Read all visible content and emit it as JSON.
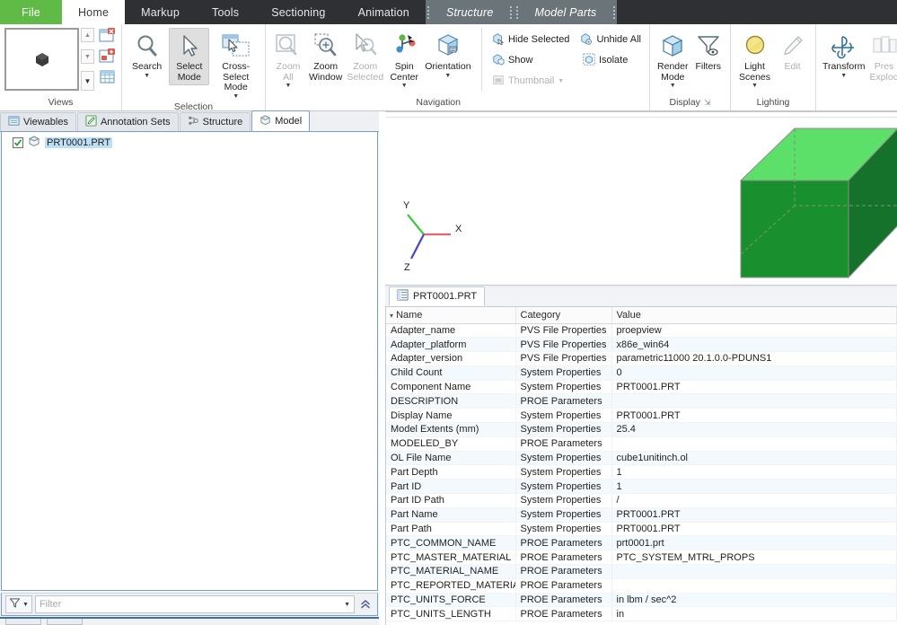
{
  "ribbon_tabs": [
    {
      "label": "File",
      "kind": "file",
      "active": false
    },
    {
      "label": "Home",
      "kind": "normal",
      "active": true
    },
    {
      "label": "Markup",
      "kind": "normal",
      "active": false
    },
    {
      "label": "Tools",
      "kind": "normal",
      "active": false
    },
    {
      "label": "Sectioning",
      "kind": "normal",
      "active": false
    },
    {
      "label": "Animation",
      "kind": "normal",
      "active": false
    }
  ],
  "contextual_tabs": [
    {
      "label": "Structure"
    },
    {
      "label": "Model Parts"
    }
  ],
  "ribbon_groups": {
    "views": {
      "label": "Views",
      "thumbnail_icon": "model-thumbnail-icon",
      "scroll_up": "scroll-up-icon",
      "scroll_down": "scroll-down-icon",
      "more": "more-views-icon",
      "side_buttons": [
        {
          "name": "delete-view-icon"
        },
        {
          "name": "new-view-icon"
        },
        {
          "name": "view-grid-icon"
        }
      ]
    },
    "selection": {
      "label": "Selection",
      "buttons": [
        {
          "label": "Search",
          "icon": "search-icon",
          "dropdown": true,
          "selected": false,
          "disabled": false
        },
        {
          "label": "Select\nMode",
          "icon": "select-mode-icon",
          "dropdown": true,
          "selected": true,
          "disabled": false
        },
        {
          "label": "Cross-Select\nMode",
          "icon": "cross-select-mode-icon",
          "dropdown": true,
          "selected": false,
          "disabled": false
        }
      ]
    },
    "navigation": {
      "label": "Navigation",
      "buttons": [
        {
          "label": "Zoom\nAll",
          "icon": "zoom-all-icon",
          "dropdown": true,
          "disabled": true
        },
        {
          "label": "Zoom\nWindow",
          "icon": "zoom-window-icon",
          "dropdown": false,
          "disabled": false
        },
        {
          "label": "Zoom\nSelected",
          "icon": "zoom-selected-icon",
          "dropdown": false,
          "disabled": true
        },
        {
          "label": "Spin\nCenter",
          "icon": "spin-center-icon",
          "dropdown": true,
          "disabled": false
        },
        {
          "label": "Orientation",
          "icon": "orientation-icon",
          "dropdown": true,
          "disabled": false
        }
      ],
      "small_buttons": [
        {
          "label": "Hide Selected",
          "icon": "hide-selected-icon",
          "disabled": false,
          "dropdown": false
        },
        {
          "label": "Unhide All",
          "icon": "unhide-all-icon",
          "disabled": false,
          "dropdown": false
        },
        {
          "label": "Show",
          "icon": "show-icon",
          "disabled": false,
          "dropdown": false
        },
        {
          "label": "Isolate",
          "icon": "isolate-icon",
          "disabled": false,
          "dropdown": false
        },
        {
          "label": "Thumbnail",
          "icon": "thumbnail-icon",
          "disabled": true,
          "dropdown": true
        }
      ]
    },
    "display": {
      "label": "Display",
      "dialog_launcher": "dialog-launcher-icon",
      "buttons": [
        {
          "label": "Render\nMode",
          "icon": "render-mode-icon",
          "dropdown": true,
          "disabled": false
        },
        {
          "label": "Filters",
          "icon": "filters-icon",
          "dropdown": false,
          "disabled": false
        }
      ]
    },
    "lighting": {
      "label": "Lighting",
      "buttons": [
        {
          "label": "Light\nScenes",
          "icon": "light-scenes-icon",
          "dropdown": true,
          "disabled": false
        },
        {
          "label": "Edit",
          "icon": "edit-pencil-icon",
          "dropdown": false,
          "disabled": true
        }
      ]
    },
    "transform_group": {
      "label": "",
      "buttons": [
        {
          "label": "Transform",
          "icon": "transform-icon",
          "dropdown": true,
          "disabled": false
        },
        {
          "label": "Pres\nExplod",
          "icon": "presentation-explode-icon",
          "dropdown": false,
          "disabled": true
        }
      ]
    }
  },
  "left_panel": {
    "tabs": [
      {
        "label": "Viewables",
        "icon": "viewables-icon",
        "active": false
      },
      {
        "label": "Annotation Sets",
        "icon": "annotation-sets-icon",
        "active": false
      },
      {
        "label": "Structure",
        "icon": "structure-icon",
        "active": false
      },
      {
        "label": "Model",
        "icon": "model-icon",
        "active": true
      }
    ],
    "tree": [
      {
        "label": "PRT0001.PRT",
        "checked": true,
        "selected": true,
        "icon": "part-cube-icon"
      }
    ],
    "filter": {
      "icon": "filter-funnel-icon",
      "placeholder": "Filter",
      "value": "",
      "dropdown_icon": "chevron-down-icon",
      "collapse_icon": "chevron-double-up-icon"
    }
  },
  "viewport": {
    "axes": {
      "x_label": "X",
      "y_label": "Y",
      "z_label": "Z",
      "x_color": "#e8646c",
      "y_color": "#3cc83c",
      "z_color": "#4444cc"
    },
    "model": {
      "name": "cube",
      "top_face_color": "#5ce06a",
      "front_face_color": "#1a8f2e",
      "right_face_color": "#14722a",
      "edge_color": "#7d7d7d"
    }
  },
  "properties": {
    "tab": {
      "label": "PRT0001.PRT",
      "icon": "properties-table-icon"
    },
    "sort_indicator": "sort-descending-icon",
    "columns": [
      "Name",
      "Category",
      "Value"
    ],
    "rows": [
      [
        "Adapter_name",
        "PVS File Properties",
        "proepview"
      ],
      [
        "Adapter_platform",
        "PVS File Properties",
        "x86e_win64"
      ],
      [
        "Adapter_version",
        "PVS File Properties",
        "parametric11000 20.1.0.0-PDUNS1"
      ],
      [
        "Child Count",
        "System Properties",
        "0"
      ],
      [
        "Component Name",
        "System Properties",
        "PRT0001.PRT"
      ],
      [
        "DESCRIPTION",
        "PROE Parameters",
        ""
      ],
      [
        "Display Name",
        "System Properties",
        "PRT0001.PRT"
      ],
      [
        "Model Extents (mm)",
        "System Properties",
        "25.4"
      ],
      [
        "MODELED_BY",
        "PROE Parameters",
        ""
      ],
      [
        "OL File Name",
        "System Properties",
        "cube1unitinch.ol"
      ],
      [
        "Part Depth",
        "System Properties",
        "1"
      ],
      [
        "Part ID",
        "System Properties",
        "1"
      ],
      [
        "Part ID Path",
        "System Properties",
        "/"
      ],
      [
        "Part Name",
        "System Properties",
        "PRT0001.PRT"
      ],
      [
        "Part Path",
        "System Properties",
        "PRT0001.PRT"
      ],
      [
        "PTC_COMMON_NAME",
        "PROE Parameters",
        "prt0001.prt"
      ],
      [
        "PTC_MASTER_MATERIAL",
        "PROE Parameters",
        "PTC_SYSTEM_MTRL_PROPS"
      ],
      [
        "PTC_MATERIAL_NAME",
        "PROE Parameters",
        ""
      ],
      [
        "PTC_REPORTED_MATERIAL",
        "PROE Parameters",
        ""
      ],
      [
        "PTC_UNITS_FORCE",
        "PROE Parameters",
        "in lbm / sec^2"
      ],
      [
        "PTC_UNITS_LENGTH",
        "PROE Parameters",
        "in"
      ]
    ]
  },
  "colors": {
    "file_tab_green": "#5fba46",
    "tabstrip_dark": "#2e3033",
    "contextual_gray": "#6b7478",
    "selection_blue": "#bde0f5",
    "panel_border_blue": "#7a9ec4"
  }
}
